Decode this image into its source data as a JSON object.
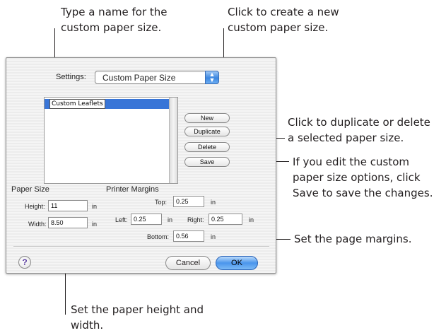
{
  "annotations": {
    "name_paper_size": [
      "Type a name for the",
      "custom paper size."
    ],
    "create_new": [
      "Click to create a new",
      "custom paper size."
    ],
    "duplicate_delete": [
      "Click to duplicate or delete",
      "a selected paper size."
    ],
    "save_changes": [
      "If you edit the custom",
      "paper size options, click",
      "Save to save the changes."
    ],
    "page_margins": [
      "Set the page margins."
    ],
    "height_width": [
      "Set the paper height and",
      "width."
    ]
  },
  "dialog": {
    "settings_label": "Settings:",
    "settings_value": "Custom Paper Size",
    "list_items": [
      "Custom Leaflets"
    ],
    "buttons": {
      "new": "New",
      "duplicate": "Duplicate",
      "delete": "Delete",
      "save": "Save"
    },
    "paper_size": {
      "heading": "Paper Size",
      "height_label": "Height:",
      "height_value": "11",
      "height_unit": "in",
      "width_label": "Width:",
      "width_value": "8.50",
      "width_unit": "in"
    },
    "printer_margins": {
      "heading": "Printer Margins",
      "top_label": "Top:",
      "top_value": "0.25",
      "left_label": "Left:",
      "left_value": "0.25",
      "right_label": "Right:",
      "right_value": "0.25",
      "bottom_label": "Bottom:",
      "bottom_value": "0.56",
      "unit": "in"
    },
    "help_label": "?",
    "cancel_label": "Cancel",
    "ok_label": "OK"
  },
  "colors": {
    "accent": "#3875d7",
    "default_button": "#4a95ec"
  },
  "icons": {
    "help": "help-icon",
    "popup": "popup-arrows-icon"
  }
}
